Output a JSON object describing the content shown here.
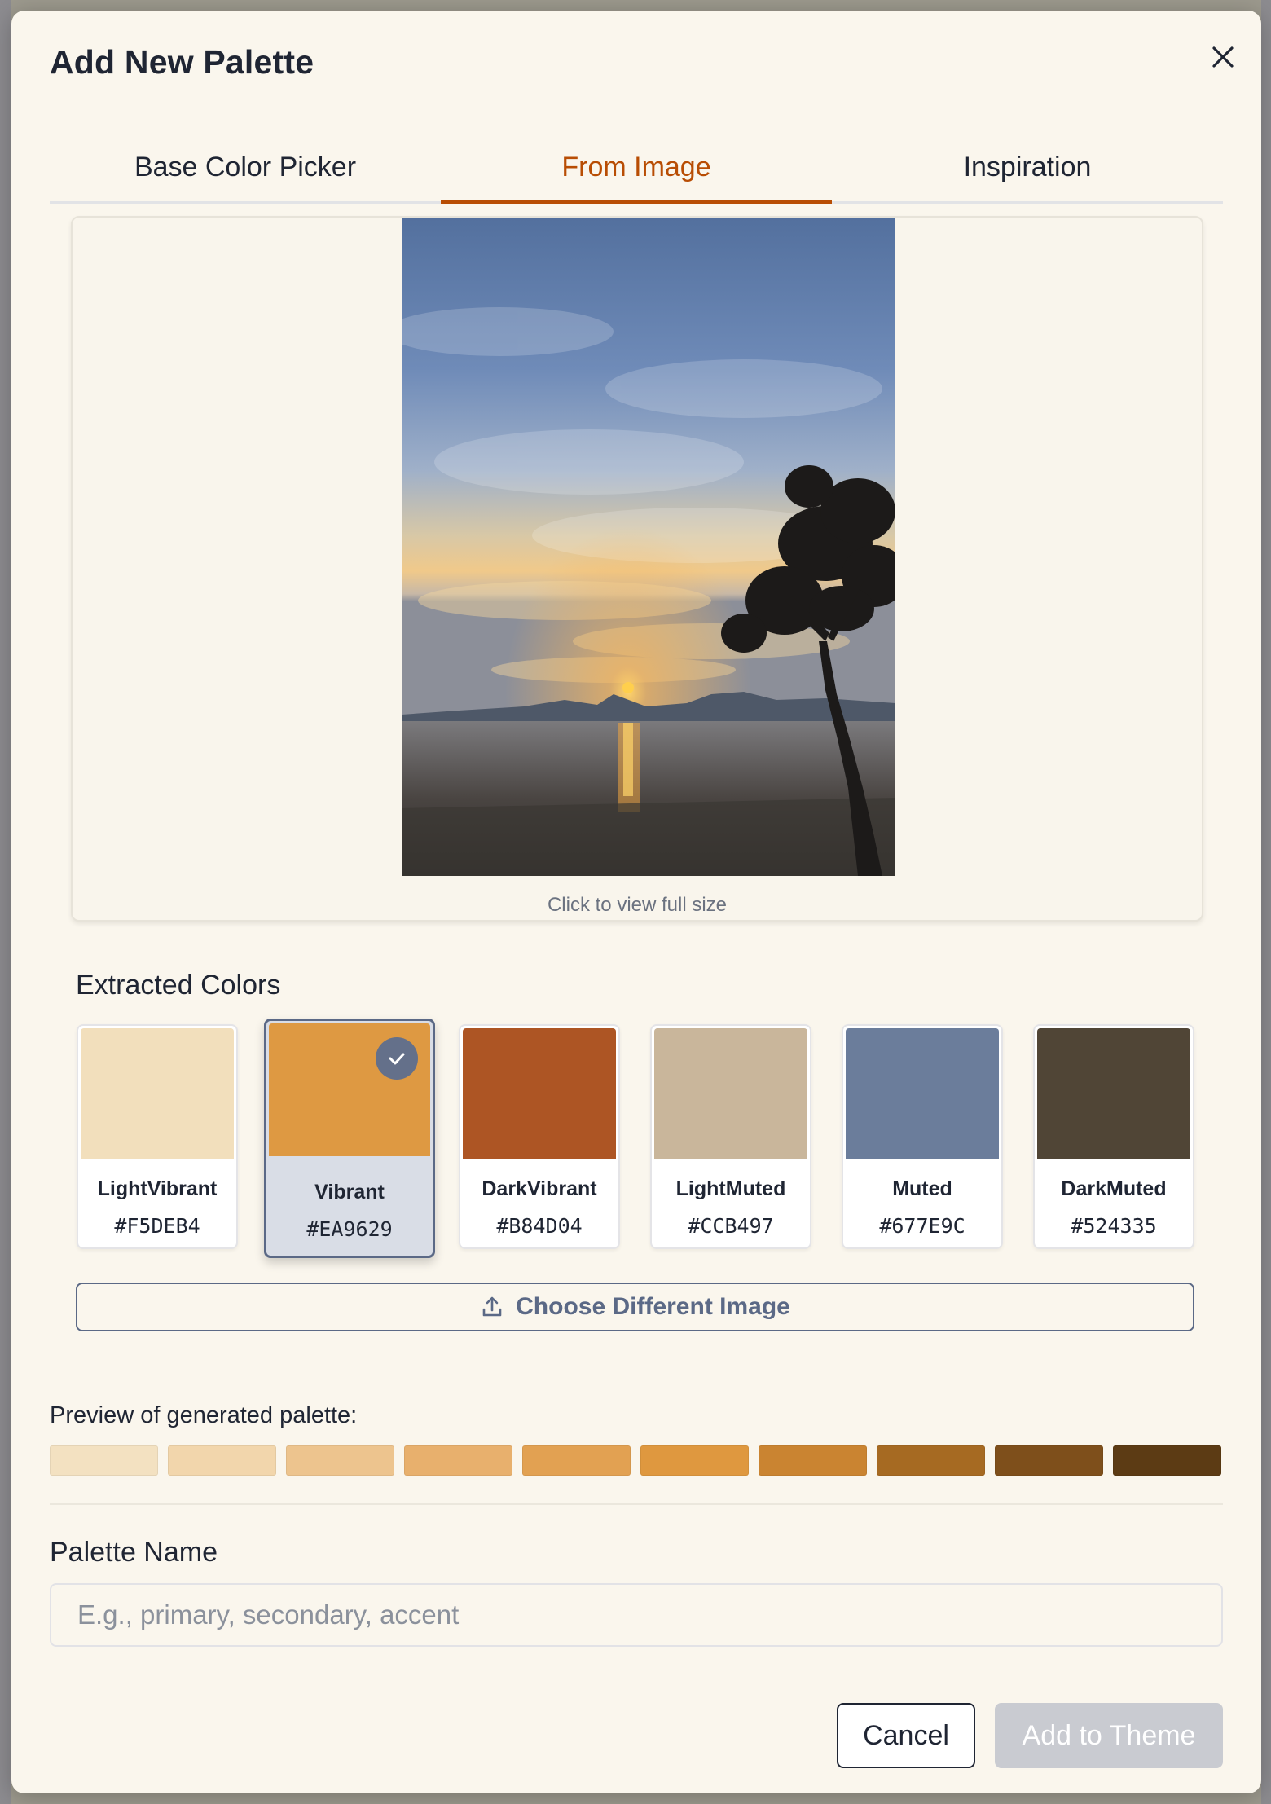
{
  "modal": {
    "title": "Add New Palette",
    "close_icon": "close-icon"
  },
  "tabs": [
    {
      "label": "Base Color Picker",
      "active": false
    },
    {
      "label": "From Image",
      "active": true
    },
    {
      "label": "Inspiration",
      "active": false
    }
  ],
  "image_preview": {
    "caption": "Click to view full size"
  },
  "extracted": {
    "label": "Extracted Colors",
    "selected": "Vibrant",
    "check_icon": "check-icon",
    "swatches": [
      {
        "name": "LightVibrant",
        "hex": "#F5DEB4",
        "color": "#f2dfbc"
      },
      {
        "name": "Vibrant",
        "hex": "#EA9629",
        "color": "#de9942"
      },
      {
        "name": "DarkVibrant",
        "hex": "#B84D04",
        "color": "#ad5524"
      },
      {
        "name": "LightMuted",
        "hex": "#CCB497",
        "color": "#c9b69b"
      },
      {
        "name": "Muted",
        "hex": "#677E9C",
        "color": "#6b7d9b"
      },
      {
        "name": "DarkMuted",
        "hex": "#524335",
        "color": "#504536"
      }
    ]
  },
  "choose_button": {
    "label": "Choose Different Image",
    "icon": "upload-icon"
  },
  "preview": {
    "label": "Preview of generated palette:",
    "ramp": [
      "#f3e1c1",
      "#f2d6ac",
      "#edc48e",
      "#e8b06d",
      "#e2a152",
      "#df983f",
      "#ca8431",
      "#a66a22",
      "#7e4f1b",
      "#5c3b14"
    ]
  },
  "palette_name": {
    "label": "Palette Name",
    "placeholder": "E.g., primary, secondary, accent",
    "value": ""
  },
  "footer": {
    "cancel_label": "Cancel",
    "add_label": "Add to Theme",
    "add_enabled": false
  },
  "colors": {
    "accent": "#b84d04",
    "modal_bg": "#faf6ed",
    "selected_border": "#5b6986",
    "disabled_button": "#c9cbd1"
  }
}
